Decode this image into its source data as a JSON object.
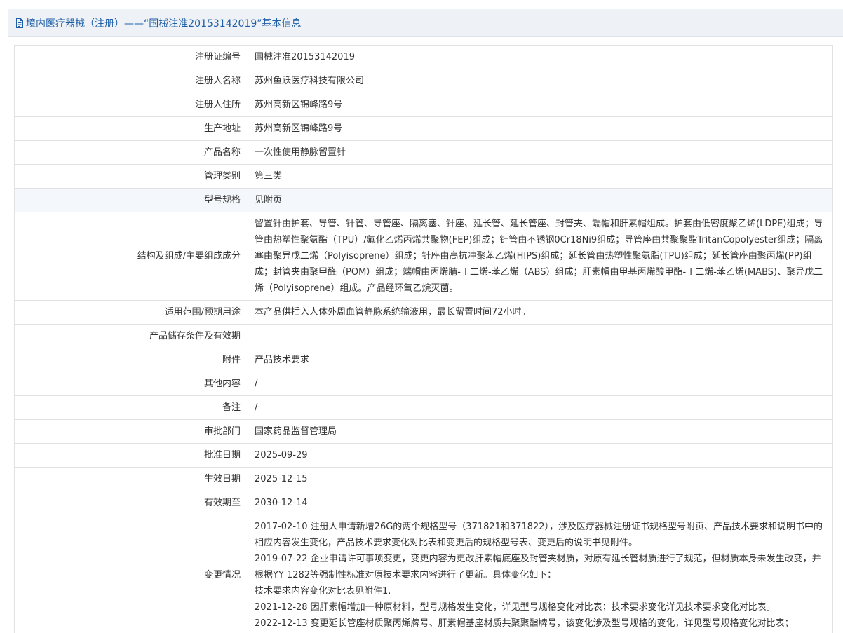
{
  "header": {
    "title": "境内医疗器械（注册）——“国械注准20153142019”基本信息",
    "icon": "document-icon"
  },
  "rows": [
    {
      "label": "注册证编号",
      "value": "国械注准20153142019"
    },
    {
      "label": "注册人名称",
      "value": "苏州鱼跃医疗科技有限公司"
    },
    {
      "label": "注册人住所",
      "value": "苏州高新区锦峰路9号"
    },
    {
      "label": "生产地址",
      "value": "苏州高新区锦峰路9号"
    },
    {
      "label": "产品名称",
      "value": "一次性使用静脉留置针"
    },
    {
      "label": "管理类别",
      "value": "第三类"
    },
    {
      "label": "型号规格",
      "value": "见附页"
    },
    {
      "label": "结构及组成/主要组成成分",
      "value": "留置针由护套、导管、针管、导管座、隔离塞、针座、延长管、延长管座、封管夹、端帽和肝素帽组成。护套由低密度聚乙烯(LDPE)组成；导管由热塑性聚氨酯（TPU）/氟化乙烯丙烯共聚物(FEP)组成；针管由不锈钢0Cr18Ni9组成；导管座由共聚聚酯TritanCopolyester组成；隔离塞由聚异戊二烯（Polyisoprene）组成；针座由高抗冲聚苯乙烯(HIPS)组成；延长管由热塑性聚氨脂(TPU)组成；延长管座由聚丙烯(PP)组成；封管夹由聚甲醛（POM）组成；端帽由丙烯腈-丁二烯-苯乙烯（ABS）组成；肝素帽由甲基丙烯酸甲酯-丁二烯-苯乙烯(MABS)、聚异戊二烯（Polyisoprene）组成。产品经环氧乙烷灭菌。"
    },
    {
      "label": "适用范围/预期用途",
      "value": "本产品供插入人体外周血管静脉系统输液用，最长留置时间72小时。"
    },
    {
      "label": "产品储存条件及有效期",
      "value": ""
    },
    {
      "label": "附件",
      "value": "产品技术要求"
    },
    {
      "label": "其他内容",
      "value": "/"
    },
    {
      "label": "备注",
      "value": "/"
    },
    {
      "label": "审批部门",
      "value": "国家药品监督管理局"
    },
    {
      "label": "批准日期",
      "value": "2025-09-29"
    },
    {
      "label": "生效日期",
      "value": "2025-12-15"
    },
    {
      "label": "有效期至",
      "value": "2030-12-14"
    }
  ],
  "changes": {
    "label": "变更情况",
    "lines": [
      "2017-02-10 注册人申请新增26G的两个规格型号（371821和371822），涉及医疗器械注册证书规格型号附页、产品技术要求和说明书中的相应内容发生变化，产品技术要求变化对比表和变更后的规格型号表、变更后的说明书见附件。",
      "2019-07-22 企业申请许可事项变更，变更内容为更改肝素帽底座及封管夹材质，对原有延长管材质进行了规范，但材质本身未发生改变，并根据YY 1282等强制性标准对原技术要求内容进行了更新。具体变化如下：",
      "技术要求内容变化对比表见附件1.",
      "2021-12-28 因肝素帽增加一种原材料，型号规格发生变化，详见型号规格变化对比表；技术要求变化详见技术要求变化对比表。",
      "2022-12-13 变更延长管座材质聚丙烯牌号、肝素帽基座材质共聚聚酯牌号，该变化涉及型号规格的变化，详见型号规格变化对比表；"
    ]
  }
}
